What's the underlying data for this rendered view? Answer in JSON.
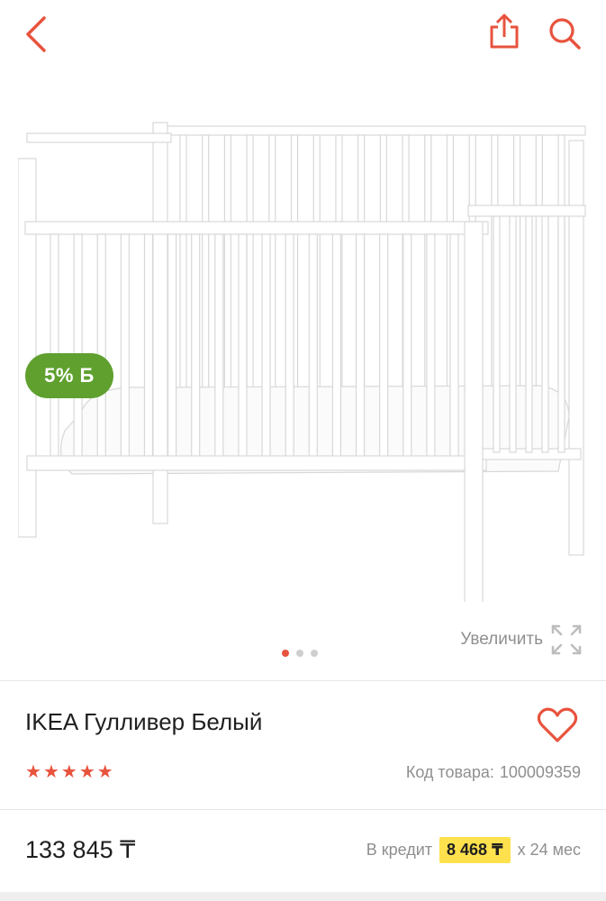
{
  "header": {
    "back_icon": "chevron-left-icon",
    "share_icon": "share-icon",
    "search_icon": "search-icon",
    "accent_color": "#e8533e"
  },
  "gallery": {
    "promo_badge": "5% Б",
    "promo_color": "#5fa02e",
    "zoom_label": "Увеличить",
    "zoom_icon": "expand-icon",
    "dots_count": 3,
    "active_dot": 1
  },
  "product": {
    "title": "IKEA Гулливер Белый",
    "rating": 5,
    "sku_label": "Код товара:",
    "sku_value": "100009359",
    "price": "133 845 ₸",
    "credit_prefix": "В кредит",
    "credit_amount": "8 468 ₸",
    "credit_term": "х 24 мес"
  }
}
